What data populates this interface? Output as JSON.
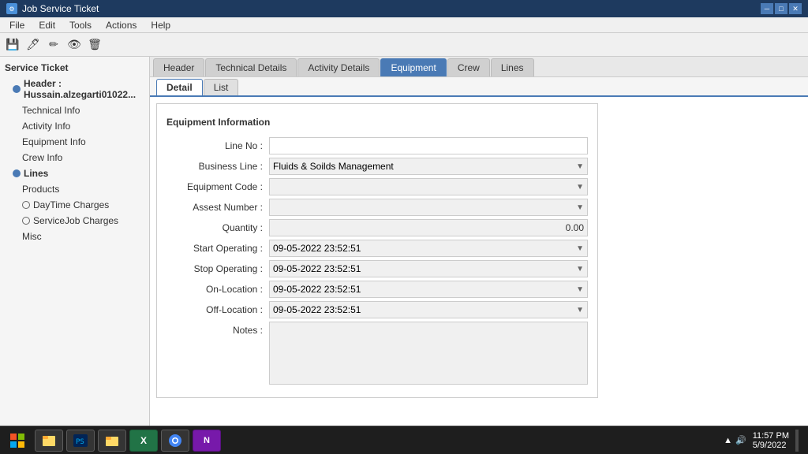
{
  "titlebar": {
    "title": "Job Service Ticket",
    "controls": {
      "minimize": "─",
      "restore": "□",
      "close": "✕"
    }
  },
  "menubar": {
    "items": [
      "File",
      "Edit",
      "Tools",
      "Actions",
      "Help"
    ]
  },
  "toolbar": {
    "buttons": [
      "💾",
      "🖊",
      "✏",
      "👁",
      "🗑"
    ]
  },
  "sidebar": {
    "items": [
      {
        "label": "Service Ticket",
        "level": 0,
        "icon": false
      },
      {
        "label": "Header : Hussain.alzegarti01022...",
        "level": 1,
        "icon": "circle"
      },
      {
        "label": "Technical Info",
        "level": 2,
        "icon": false
      },
      {
        "label": "Activity Info",
        "level": 2,
        "icon": false
      },
      {
        "label": "Equipment Info",
        "level": 2,
        "icon": false
      },
      {
        "label": "Crew Info",
        "level": 2,
        "icon": false
      },
      {
        "label": "Lines",
        "level": 1,
        "icon": "circle"
      },
      {
        "label": "Products",
        "level": 2,
        "icon": false
      },
      {
        "label": "DayTime Charges",
        "level": 2,
        "icon": "circle"
      },
      {
        "label": "ServiceJob Charges",
        "level": 2,
        "icon": "circle"
      },
      {
        "label": "Misc",
        "level": 2,
        "icon": false
      }
    ]
  },
  "tabs": {
    "items": [
      "Header",
      "Technical Details",
      "Activity Details",
      "Equipment",
      "Crew",
      "Lines"
    ],
    "active": "Equipment"
  },
  "subtabs": {
    "items": [
      "Detail",
      "List"
    ],
    "active": "Detail"
  },
  "form": {
    "section_title": "Equipment Information",
    "fields": {
      "line_no_label": "Line No :",
      "line_no_value": "",
      "business_line_label": "Business Line :",
      "business_line_value": "Fluids & Soilds Management",
      "equipment_code_label": "Equipment Code :",
      "equipment_code_value": "",
      "assest_number_label": "Assest Number :",
      "assest_number_value": "",
      "quantity_label": "Quantity :",
      "quantity_value": "0.00",
      "start_operating_label": "Start Operating :",
      "start_operating_value": "09-05-2022 23:52:51",
      "stop_operating_label": "Stop Operating :",
      "stop_operating_value": "09-05-2022 23:52:51",
      "on_location_label": "On-Location :",
      "on_location_value": "09-05-2022 23:52:51",
      "off_location_label": "Off-Location :",
      "off_location_value": "09-05-2022 23:52:51",
      "notes_label": "Notes :",
      "notes_value": ""
    }
  },
  "taskbar": {
    "time": "11:57 PM",
    "date": "5/9/2022"
  }
}
